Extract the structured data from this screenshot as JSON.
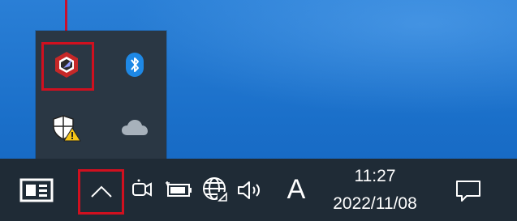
{
  "colors": {
    "desktop": "#1a6fc9",
    "taskbar": "#1f2b36",
    "overflow_panel": "#2a3744",
    "highlight": "#d0101f",
    "bluetooth": "#1e88e5"
  },
  "overflow_tray": {
    "icons": [
      {
        "name": "app-icon"
      },
      {
        "name": "bluetooth-icon"
      },
      {
        "name": "windows-security-warning-icon"
      },
      {
        "name": "onedrive-cloud-icon"
      }
    ]
  },
  "taskbar": {
    "icons": [
      {
        "name": "news-widget-icon"
      },
      {
        "name": "show-hidden-icons-chevron"
      },
      {
        "name": "meet-now-icon"
      },
      {
        "name": "battery-icon"
      },
      {
        "name": "network-globe-icon"
      },
      {
        "name": "volume-icon"
      },
      {
        "name": "notifications-icon"
      }
    ],
    "ime_label": "A",
    "time": "11:27",
    "date": "2022/11/08"
  }
}
